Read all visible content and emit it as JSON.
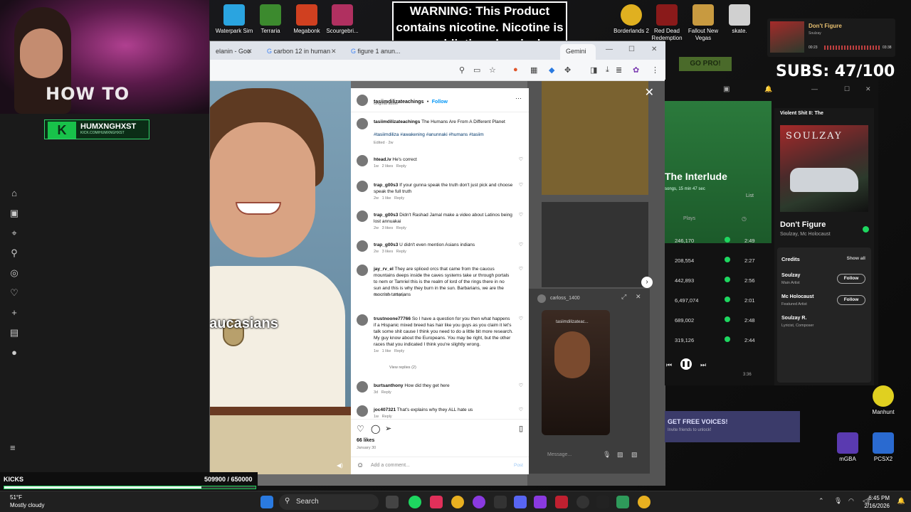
{
  "warning": {
    "text": "WARNING: This Product contains nicotine. Nicotine is an addictive chemical."
  },
  "desktop_icons_top": [
    {
      "label": "Waterpark Sim",
      "color": "#2aa4e0"
    },
    {
      "label": "Terraria",
      "color": "#3c8a2e"
    },
    {
      "label": "Megabonk",
      "color": "#d04020"
    },
    {
      "label": "Scourgebri...",
      "color": "#b03060"
    },
    {
      "label": "Borderlands 2",
      "color": "#e0b020"
    },
    {
      "label": "Red Dead Redemption",
      "color": "#8a1a1a"
    },
    {
      "label": "Fallout New Vegas",
      "color": "#c89a40"
    },
    {
      "label": "skate.",
      "color": "#d0d0d0"
    }
  ],
  "desktop_icons_right": [
    {
      "label": "Manhunt",
      "color": "#e0d020"
    },
    {
      "label": "mGBA",
      "color": "#5a3ab0"
    },
    {
      "label": "PCSX2",
      "color": "#2a6ad0"
    }
  ],
  "webcam": {
    "title": "HOW TO",
    "channel": "HUMXNGHXST",
    "channel_url": "KICK.COM/HUMXNGHXST"
  },
  "subs": {
    "text": "SUBS: 47/100"
  },
  "now_playing": {
    "title": "Don't Figure",
    "artist": "Soulzay",
    "elapsed": "00:23",
    "total": "03:38"
  },
  "browser": {
    "tabs": [
      {
        "label": "elanin - Goo"
      },
      {
        "label": "carbon 12 in human"
      },
      {
        "label": "figure 1 anun..."
      },
      {
        "label": "Gemini"
      }
    ]
  },
  "video": {
    "caption": "caucasians"
  },
  "post": {
    "author": "tasiimdilizateachings",
    "follow": "Follow",
    "audio": "Original audio",
    "caption_author": "tasiimdilizateachings",
    "caption": "The Humans Are From A Different Planet",
    "hashtags": "#tasiimdiliza #awakening #anunnaki #humans #tasiim",
    "edited": "Edited · 2w",
    "likes": "66 likes",
    "date": "January 30",
    "add_comment": "Add a comment...",
    "post_btn": "Post"
  },
  "comments": [
    {
      "user": "htead.iv",
      "text": "He's correct",
      "meta": "1w   2 likes   Reply"
    },
    {
      "user": "trap_g00s3",
      "text": "If your gunna speak the truth don't just pick and choose speak the full truth",
      "meta": "2w   1 like   Reply"
    },
    {
      "user": "trap_g00s3",
      "text": "Didn't Rashad Jamal make a video about Latinos being lost annuakai",
      "meta": "2w   3 likes   Reply"
    },
    {
      "user": "trap_g00s3",
      "text": "U didn't even mention Asians indians",
      "meta": "2w   3 likes   Reply"
    },
    {
      "user": "jay_rv_el",
      "text": "They are spliced orcs that came from the caucus mountains deeps inside the caves systems take ur through portals to nem or Tamriel this is the realm of lord of the rings there in no sun and this is why they burn in the sun. Barbarians, we are the moorish tartarians",
      "meta": "2w   1 like   Reply"
    },
    {
      "user": "trustnoone77766",
      "text": "So I have a question for you then what happens if a Hispanic mixed breed has hair like you guys as you claim it let's talk some shit cause I think you need to do a little bit more research. My guy know about the Europeans. You may be right, but the other races that you indicated I think you're slightly wrong.",
      "meta": "1w   1 like   Reply"
    },
    {
      "user": "burtsanthony",
      "text": "How did they get here",
      "meta": "3d   Reply"
    },
    {
      "user": "joc407321",
      "text": "That's explains why they ALL hate us",
      "meta": "1w   Reply"
    }
  ],
  "view_replies": "View replies (2)",
  "float_window": {
    "user": "carloss_1400",
    "label": "tasiimdilizateac...",
    "message": "Message..."
  },
  "music": {
    "album_title": "The Interlude",
    "album_sub": "songs, 15 min 47 sec",
    "list": "List",
    "plays_header": "Plays",
    "rows": [
      {
        "plays": "246,170",
        "dur": "2:49"
      },
      {
        "plays": "208,554",
        "dur": "2:27"
      },
      {
        "plays": "442,893",
        "dur": "2:56"
      },
      {
        "plays": "6,497,074",
        "dur": "2:01"
      },
      {
        "plays": "689,002",
        "dur": "2:48"
      },
      {
        "plays": "319,126",
        "dur": "2:44"
      }
    ],
    "playlist_name": "Violent Shit II: The",
    "art_text": "SOULZAY",
    "track": "Don't Figure",
    "artists": "Soulzay, Mc Holocaust",
    "credits": "Credits",
    "show_all": "Show all",
    "credit_list": [
      {
        "name": "Soulzay",
        "role": "Main Artist",
        "btn": "Follow"
      },
      {
        "name": "Mc Holocaust",
        "role": "Featured Artist",
        "btn": "Follow"
      },
      {
        "name": "Soulzay R.",
        "role": "Lyricist, Composer"
      }
    ],
    "time_total": "3:36"
  },
  "ad": {
    "line1": "GET FREE VOICES!",
    "line2": "Invite friends to unlock!"
  },
  "go_pro": "GO PRO!",
  "kicks": {
    "label": "KICKS",
    "value": "509900  / 650000",
    "progress": 0.7845
  },
  "taskbar": {
    "search": "Search",
    "temp": "51°F",
    "weather": "Mostly cloudy",
    "time": "6:45 PM",
    "date": "2/16/2026"
  },
  "colors": {
    "accent_green": "#1ed760",
    "kick_green": "#1dd15a",
    "warning_bg": "#000000"
  }
}
